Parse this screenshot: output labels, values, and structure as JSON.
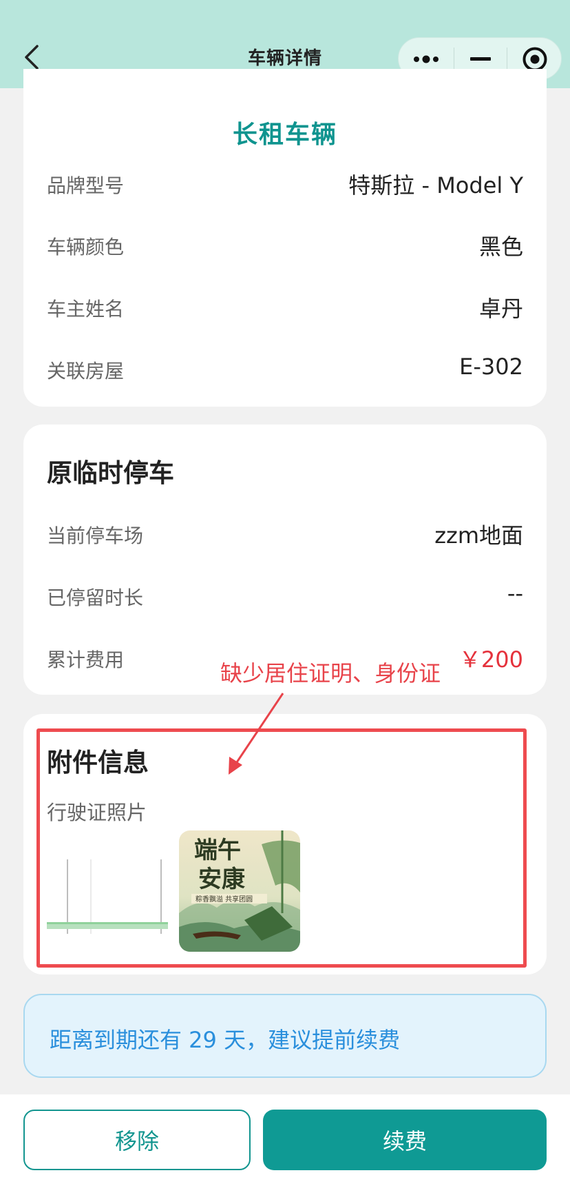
{
  "nav": {
    "title": "车辆详情",
    "bg_color": "#b8e6dc"
  },
  "vehicle": {
    "type_title": "长租车辆",
    "rows": [
      {
        "label": "品牌型号",
        "value": "特斯拉 - Model Y"
      },
      {
        "label": "车辆颜色",
        "value": "黑色"
      },
      {
        "label": "车主姓名",
        "value": "卓丹"
      },
      {
        "label": "关联房屋",
        "value": "E-302"
      }
    ]
  },
  "parking": {
    "title": "原临时停车",
    "rows": [
      {
        "label": "当前停车场",
        "value": "zzm地面"
      },
      {
        "label": "已停留时长",
        "value": "--"
      },
      {
        "label": "累计费用",
        "value": "￥200"
      }
    ]
  },
  "annotation": {
    "text": "缺少居住证明、身份证",
    "color": "#e8434a"
  },
  "attachments": {
    "title": "附件信息",
    "photo_label": "行驶证照片",
    "image_text": {
      "line1": "端午",
      "line2": "安康",
      "caption": "粽香飘溢 共享团圆"
    }
  },
  "notice": {
    "text": "距离到期还有 29 天，建议提前续费"
  },
  "actions": {
    "remove_label": "移除",
    "renew_label": "续费",
    "accent_color": "#0f9a94"
  }
}
